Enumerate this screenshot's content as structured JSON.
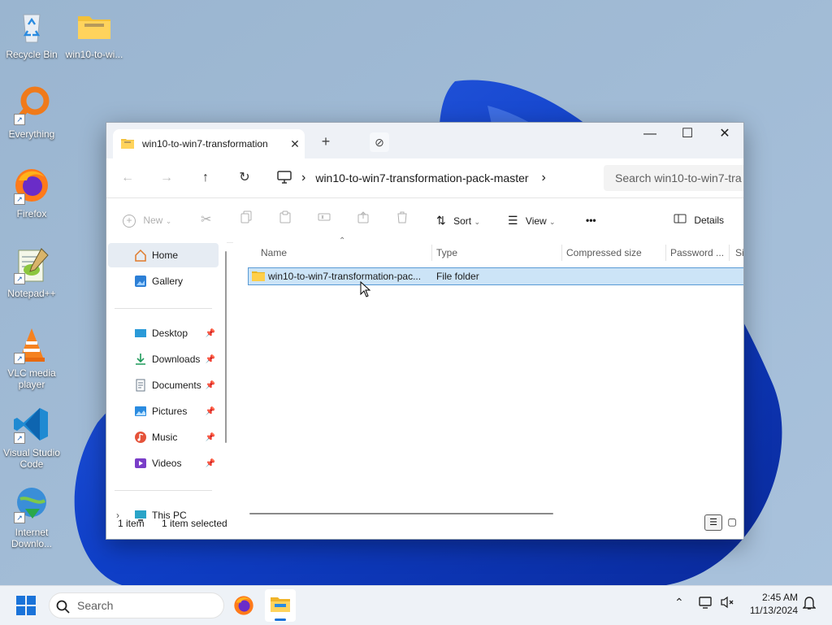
{
  "desktop": {
    "icons": [
      {
        "label": "Recycle Bin",
        "icon": "recycle-bin-icon"
      },
      {
        "label": "win10-to-wi...",
        "icon": "zip-folder-icon"
      },
      {
        "label": "Everything",
        "icon": "everything-search-icon"
      },
      {
        "label": "Firefox",
        "icon": "firefox-icon"
      },
      {
        "label": "Notepad++",
        "icon": "notepadpp-icon"
      },
      {
        "label": "VLC media player",
        "icon": "vlc-icon"
      },
      {
        "label": "Visual Studio Code",
        "icon": "vscode-icon"
      },
      {
        "label": "Internet Downlo...",
        "icon": "idm-icon"
      }
    ]
  },
  "window": {
    "tab": {
      "title": "win10-to-win7-transformation",
      "close": "✕"
    },
    "new_tab": "+",
    "blocked_icon": "⊘",
    "controls": {
      "minimize": "—",
      "maximize": "☐",
      "close": "✕"
    },
    "nav": {
      "back": "←",
      "forward": "→",
      "up": "↑",
      "refresh": "↻",
      "chevron": "›"
    },
    "address": {
      "path": "win10-to-win7-transformation-pack-master"
    },
    "search": {
      "placeholder": "Search win10-to-win7-tra"
    },
    "toolbar": {
      "new": "New",
      "sort": "Sort",
      "view": "View",
      "more": "•••",
      "details": "Details"
    },
    "sidebar": {
      "items": [
        {
          "label": "Home",
          "icon": "home-icon"
        },
        {
          "label": "Gallery",
          "icon": "gallery-icon"
        },
        {
          "label": "Desktop",
          "icon": "desktop-icon",
          "pinned": true
        },
        {
          "label": "Downloads",
          "icon": "downloads-icon",
          "pinned": true
        },
        {
          "label": "Documents",
          "icon": "documents-icon",
          "pinned": true
        },
        {
          "label": "Pictures",
          "icon": "pictures-icon",
          "pinned": true
        },
        {
          "label": "Music",
          "icon": "music-icon",
          "pinned": true
        },
        {
          "label": "Videos",
          "icon": "videos-icon",
          "pinned": true
        },
        {
          "label": "This PC",
          "icon": "this-pc-icon"
        }
      ]
    },
    "columns": [
      "Name",
      "Type",
      "Compressed size",
      "Password ...",
      "Si"
    ],
    "rows": [
      {
        "name": "win10-to-win7-transformation-pac...",
        "type": "File folder"
      }
    ],
    "status": {
      "count": "1 item",
      "selected": "1 item selected"
    }
  },
  "taskbar": {
    "search_placeholder": "Search",
    "time": "2:45 AM",
    "date": "11/13/2024"
  }
}
